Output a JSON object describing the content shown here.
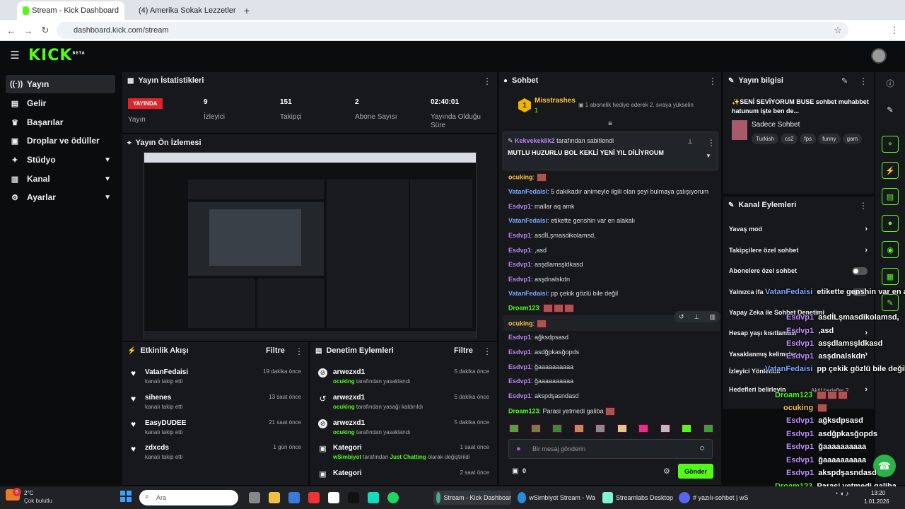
{
  "browser": {
    "tabs": [
      {
        "title": "Stream - Kick Dashboard"
      },
      {
        "title": "(4) Amerika Sokak Lezzetleri !"
      }
    ],
    "url": "dashboard.kick.com/stream"
  },
  "app": {
    "logo": "KICK",
    "logo_badge": "BETA"
  },
  "sidebar": {
    "items": [
      {
        "label": "Yayın",
        "icon": "broadcast-icon"
      },
      {
        "label": "Gelir",
        "icon": "revenue-icon"
      },
      {
        "label": "Başarılar",
        "icon": "trophy-icon"
      },
      {
        "label": "Droplar ve ödüller",
        "icon": "gift-icon"
      },
      {
        "label": "Stüdyo",
        "icon": "studio-icon"
      },
      {
        "label": "Kanal",
        "icon": "channel-icon"
      },
      {
        "label": "Ayarlar",
        "icon": "settings-icon"
      }
    ]
  },
  "stats": {
    "title": "Yayın İstatistikleri",
    "live_badge": "YAYINDA",
    "live_label": "Yayın",
    "items": [
      {
        "value": "9",
        "label": "İzleyici"
      },
      {
        "value": "151",
        "label": "Takipçi"
      },
      {
        "value": "2",
        "label": "Abone Sayısı"
      },
      {
        "value": "02:40:01",
        "label": "Yayında Olduğu Süre"
      }
    ]
  },
  "preview": {
    "title": "Yayın Ön İzlemesi"
  },
  "activity": {
    "title": "Etkinlik Akışı",
    "filter": "Filtre",
    "items": [
      {
        "name": "VatanFedaisi",
        "sub": "kanalı takip etti",
        "time": "19 dakika önce"
      },
      {
        "name": "sihenes",
        "sub": "kanalı takip etti",
        "time": "13 saat önce"
      },
      {
        "name": "EasyDUDEE",
        "sub": "kanalı takip etti",
        "time": "21 saat önce"
      },
      {
        "name": "zdxcds",
        "sub": "kanalı takip etti",
        "time": "1 gün önce"
      }
    ]
  },
  "moderation": {
    "title": "Denetim Eylemleri",
    "filter": "Filtre",
    "items": [
      {
        "name": "arwezxd1",
        "by": "ocuking",
        "text": "tarafından yasaklandı",
        "time": "5 dakika önce"
      },
      {
        "name": "arwezxd1",
        "by": "ocuking",
        "text": "tarafından yasağı kaldırıldı",
        "time": "5 dakika önce"
      },
      {
        "name": "arwezxd1",
        "by": "ocuking",
        "text": "tarafından yasaklandı",
        "time": "5 dakika önce"
      },
      {
        "name": "Kategori",
        "by": "wSimbiyot",
        "text": "tarafından",
        "extra": "Just Chatting",
        "extra2": "olarak değiştirildi",
        "time": "1 saat önce"
      },
      {
        "name": "Kategori",
        "by": "",
        "text": "",
        "time": "2 saat önce"
      }
    ]
  },
  "chat": {
    "title": "Sohbet",
    "top_gifter": "Misstrashes",
    "top_gifter_count": "1",
    "gift_promo": "1 abonelik hediye ederek 2. sıraya yükselin",
    "pinned_user": "Kekvekeklik2",
    "pinned_by": "tarafından sabitlendi",
    "pinned_text": "MUTLU HUZURLU BOL KEKLİ YENİ YIL DİLİYROUM",
    "messages": [
      {
        "user": "ocuking",
        "text": ""
      },
      {
        "user": "VatanFedaisi",
        "text": "5 dakikadır animeyle ilgili olan şeyi bulmaya çalışıyorum"
      },
      {
        "user": "Esdvp1",
        "text": "mallar aq amk"
      },
      {
        "user": "VatanFedaisi",
        "text": "etikette genshin var en alakalı"
      },
      {
        "user": "Esdvp1",
        "text": "asdİLşmasdikolamsd,"
      },
      {
        "user": "Esdvp1",
        "text": ",asd"
      },
      {
        "user": "Esdvp1",
        "text": "asşdlamsşldkasd"
      },
      {
        "user": "Esdvp1",
        "text": "asşdnalskdn"
      },
      {
        "user": "VatanFedaisi",
        "text": "pp çekik gözlü bile değil"
      },
      {
        "user": "Droam123",
        "text": ""
      },
      {
        "user": "ocuking",
        "text": ""
      },
      {
        "user": "Esdvp1",
        "text": "ağksdpsasd"
      },
      {
        "user": "Esdvp1",
        "text": "asdğpkasğopds"
      },
      {
        "user": "Esdvp1",
        "text": "ğaaaaaaaaaa"
      },
      {
        "user": "Esdvp1",
        "text": "ğaaaaaaaaaa"
      },
      {
        "user": "Esdvp1",
        "text": "akspdşasndasd"
      },
      {
        "user": "Droam123",
        "text": "Parasi yetmedi galiba"
      }
    ],
    "input_placeholder": "Bir mesaj gönderin",
    "points": "0",
    "send_label": "Gönder"
  },
  "info": {
    "title": "Yayın bilgisi",
    "stream_title": "✨SENİ SEVİYORUM BUSE sohbet muhabbet hatunum işte ben de...",
    "category": "Sadece Sohbet",
    "tags": [
      "Turkish",
      "cs2",
      "fps",
      "funny",
      "gam"
    ]
  },
  "actions": {
    "title": "Kanal Eylemleri",
    "items": [
      {
        "label": "Yavaş mod",
        "control": "chevron"
      },
      {
        "label": "Takipçilere özel sohbet",
        "control": "chevron"
      },
      {
        "label": "Abonelere özel sohbet",
        "control": "toggle"
      },
      {
        "label": "Yalnızca ifa",
        "control": "toggle"
      },
      {
        "label": "Yapay Zeka ile Sohbet Denetimi",
        "control": "none"
      },
      {
        "label": "Hesap yaşı kısıtlaması",
        "control": "chevron"
      },
      {
        "label": "Yasaklanmış kelimeler",
        "control": "chevron"
      },
      {
        "label": "İzleyici Yönlendir",
        "control": "none"
      },
      {
        "label": "Hedefleri belirleyin",
        "control": "chevron"
      }
    ],
    "extra_label": "Aktif hedefler 2"
  },
  "overlay_chat": [
    {
      "user": "VatanFedaisi",
      "text": "etikette genshin var en alakalı"
    },
    {
      "user": "Esdvp1",
      "text": "asdİLşmasdikolamsd,"
    },
    {
      "user": "Esdvp1",
      "text": ",asd"
    },
    {
      "user": "Esdvp1",
      "text": "asşdlamsşldkasd"
    },
    {
      "user": "Esdvp1",
      "text": "asşdnalskdn"
    },
    {
      "user": "VatanFedaisi",
      "text": "pp çekik gözlü bile değil"
    },
    {
      "user": "Droam123",
      "text": ""
    },
    {
      "user": "ocuking",
      "text": ""
    },
    {
      "user": "Esdvp1",
      "text": "ağksdpsasd"
    },
    {
      "user": "Esdvp1",
      "text": "asdğpkasğopds"
    },
    {
      "user": "Esdvp1",
      "text": "ğaaaaaaaaaa"
    },
    {
      "user": "Esdvp1",
      "text": "ğaaaaaaaaaa"
    },
    {
      "user": "Esdvp1",
      "text": "akspdşasndasd"
    },
    {
      "user": "Droam123",
      "text": "Parasi yetmedi galiba"
    }
  ],
  "taskbar": {
    "weather_temp": "2°C",
    "weather_text": "Çok bulutlu",
    "search_placeholder": "Ara",
    "apps": [
      "Stream - Kick Dashboar",
      "wSimbiyot Stream - Wa",
      "Streamlabs Desktop",
      "# yazılı-sohbet | wS"
    ],
    "time": "13:20",
    "date": "1.01.2026",
    "notif_count": "6"
  },
  "colors": {
    "accent": "#53fc18",
    "live": "#e3222a",
    "panel": "#16181b",
    "bg": "#0b0c0d"
  }
}
